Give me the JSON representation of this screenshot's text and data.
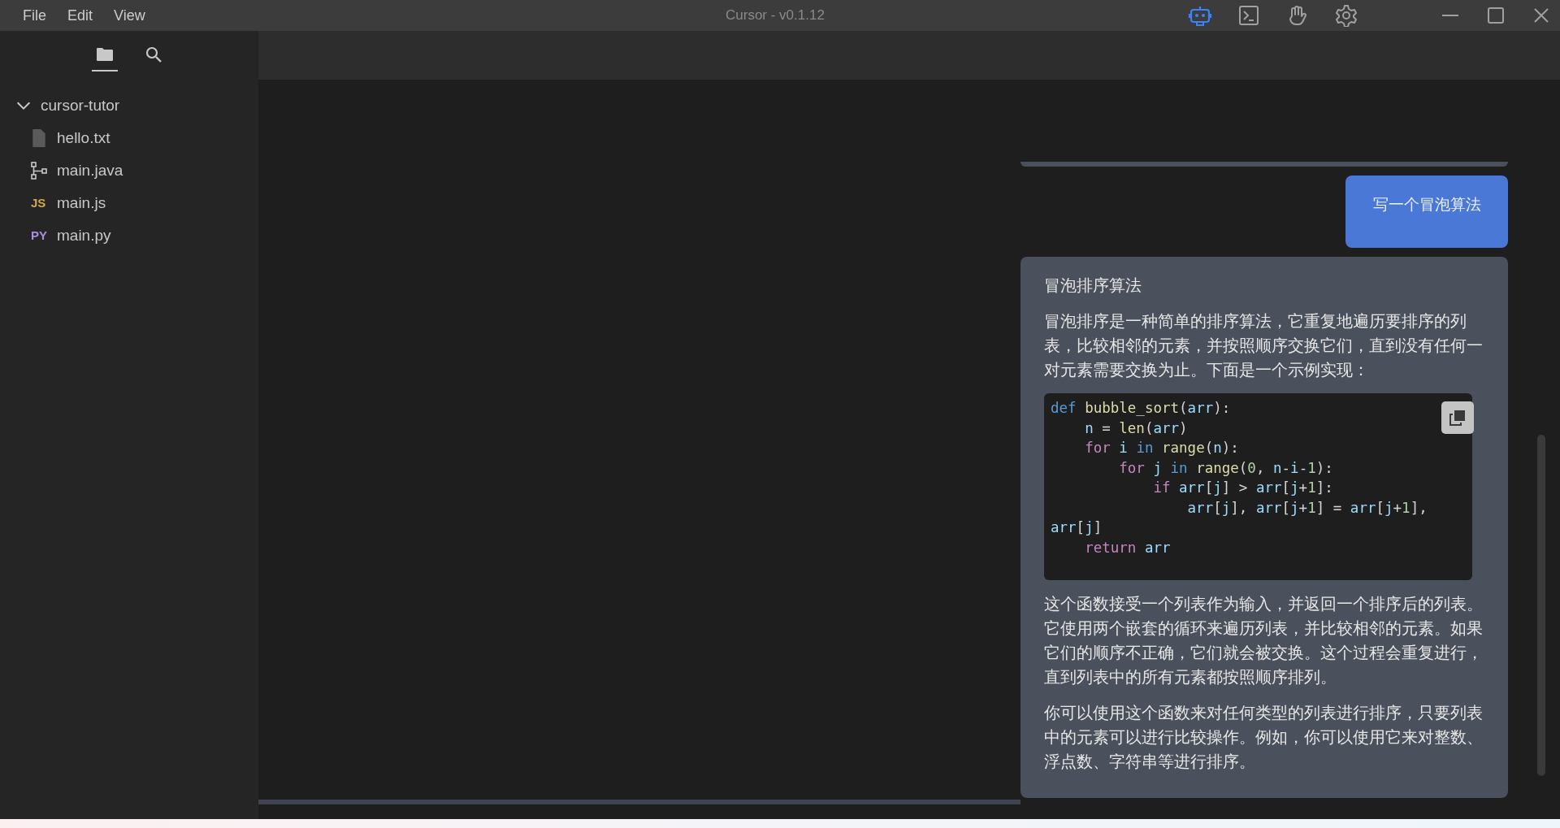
{
  "window": {
    "title": "Cursor - v0.1.12"
  },
  "menu": [
    "File",
    "Edit",
    "View"
  ],
  "toolbar": [
    {
      "kind": "robot",
      "selected": true
    },
    {
      "kind": "terminal",
      "selected": false
    },
    {
      "kind": "hand",
      "selected": false
    },
    {
      "kind": "settings",
      "selected": false
    }
  ],
  "sidebar": {
    "tabs": [
      {
        "kind": "files",
        "selected": true
      },
      {
        "kind": "search",
        "selected": false
      }
    ],
    "tree": {
      "label": "cursor-tutor",
      "expanded": true,
      "children": [
        {
          "label": "hello.txt",
          "kind": "text"
        },
        {
          "label": "main.java",
          "kind": "java"
        },
        {
          "label": "main.js",
          "kind": "js",
          "badge": "JS"
        },
        {
          "label": "main.py",
          "kind": "py",
          "badge": "PY"
        }
      ]
    }
  },
  "chat": {
    "messages": [
      {
        "kind": "user",
        "text": "写一个冒泡算法"
      },
      {
        "kind": "assistant",
        "blocks": [
          {
            "kind": "heading",
            "text": "冒泡排序算法"
          },
          {
            "kind": "paragraph",
            "text": "冒泡排序是一种简单的排序算法，它重复地遍历要排序的列表，比较相邻的元素，并按照顺序交换它们，直到没有任何一对元素需要交换为止。下面是一个示例实现："
          },
          {
            "kind": "code",
            "lines": [
              [
                {
                  "t": "def ",
                  "kind": "keyword"
                },
                {
                  "t": "bubble_sort",
                  "kind": "function"
                },
                {
                  "t": "(",
                  "kind": "plain"
                },
                {
                  "t": "arr",
                  "kind": "variable"
                },
                {
                  "t": "):",
                  "kind": "plain"
                }
              ],
              [
                {
                  "t": "    n",
                  "kind": "variable"
                },
                {
                  "t": " = ",
                  "kind": "plain"
                },
                {
                  "t": "len",
                  "kind": "function"
                },
                {
                  "t": "(",
                  "kind": "plain"
                },
                {
                  "t": "arr",
                  "kind": "variable"
                },
                {
                  "t": ")",
                  "kind": "plain"
                }
              ],
              [
                {
                  "t": "    for ",
                  "kind": "control"
                },
                {
                  "t": "i ",
                  "kind": "variable"
                },
                {
                  "t": "in ",
                  "kind": "keyword"
                },
                {
                  "t": "range",
                  "kind": "function"
                },
                {
                  "t": "(",
                  "kind": "plain"
                },
                {
                  "t": "n",
                  "kind": "variable"
                },
                {
                  "t": "):",
                  "kind": "plain"
                }
              ],
              [
                {
                  "t": "        for ",
                  "kind": "control"
                },
                {
                  "t": "j ",
                  "kind": "variable"
                },
                {
                  "t": "in ",
                  "kind": "keyword"
                },
                {
                  "t": "range",
                  "kind": "function"
                },
                {
                  "t": "(",
                  "kind": "plain"
                },
                {
                  "t": "0",
                  "kind": "number"
                },
                {
                  "t": ", ",
                  "kind": "plain"
                },
                {
                  "t": "n",
                  "kind": "variable"
                },
                {
                  "t": "-",
                  "kind": "plain"
                },
                {
                  "t": "i",
                  "kind": "variable"
                },
                {
                  "t": "-",
                  "kind": "plain"
                },
                {
                  "t": "1",
                  "kind": "number"
                },
                {
                  "t": "):",
                  "kind": "plain"
                }
              ],
              [
                {
                  "t": "            if ",
                  "kind": "control"
                },
                {
                  "t": "arr",
                  "kind": "variable"
                },
                {
                  "t": "[",
                  "kind": "plain"
                },
                {
                  "t": "j",
                  "kind": "variable"
                },
                {
                  "t": "] > ",
                  "kind": "plain"
                },
                {
                  "t": "arr",
                  "kind": "variable"
                },
                {
                  "t": "[",
                  "kind": "plain"
                },
                {
                  "t": "j",
                  "kind": "variable"
                },
                {
                  "t": "+",
                  "kind": "plain"
                },
                {
                  "t": "1",
                  "kind": "number"
                },
                {
                  "t": "]:",
                  "kind": "plain"
                }
              ],
              [
                {
                  "t": "                arr",
                  "kind": "variable"
                },
                {
                  "t": "[",
                  "kind": "plain"
                },
                {
                  "t": "j",
                  "kind": "variable"
                },
                {
                  "t": "], ",
                  "kind": "plain"
                },
                {
                  "t": "arr",
                  "kind": "variable"
                },
                {
                  "t": "[",
                  "kind": "plain"
                },
                {
                  "t": "j",
                  "kind": "variable"
                },
                {
                  "t": "+",
                  "kind": "plain"
                },
                {
                  "t": "1",
                  "kind": "number"
                },
                {
                  "t": "] = ",
                  "kind": "plain"
                },
                {
                  "t": "arr",
                  "kind": "variable"
                },
                {
                  "t": "[",
                  "kind": "plain"
                },
                {
                  "t": "j",
                  "kind": "variable"
                },
                {
                  "t": "+",
                  "kind": "plain"
                },
                {
                  "t": "1",
                  "kind": "number"
                },
                {
                  "t": "],",
                  "kind": "plain"
                }
              ],
              [
                {
                  "t": "arr",
                  "kind": "variable"
                },
                {
                  "t": "[",
                  "kind": "plain"
                },
                {
                  "t": "j",
                  "kind": "variable"
                },
                {
                  "t": "]",
                  "kind": "plain"
                }
              ],
              [
                {
                  "t": "    return ",
                  "kind": "control"
                },
                {
                  "t": "arr",
                  "kind": "variable"
                }
              ]
            ]
          },
          {
            "kind": "paragraph",
            "text": "这个函数接受一个列表作为输入，并返回一个排序后的列表。它使用两个嵌套的循环来遍历列表，并比较相邻的元素。如果它们的顺序不正确，它们就会被交换。这个过程会重复进行，直到列表中的所有元素都按照顺序排列。"
          },
          {
            "kind": "paragraph",
            "text": "你可以使用这个函数来对任何类型的列表进行排序，只要列表中的元素可以进行比较操作。例如，你可以使用它来对整数、浮点数、字符串等进行排序。"
          }
        ]
      }
    ]
  }
}
